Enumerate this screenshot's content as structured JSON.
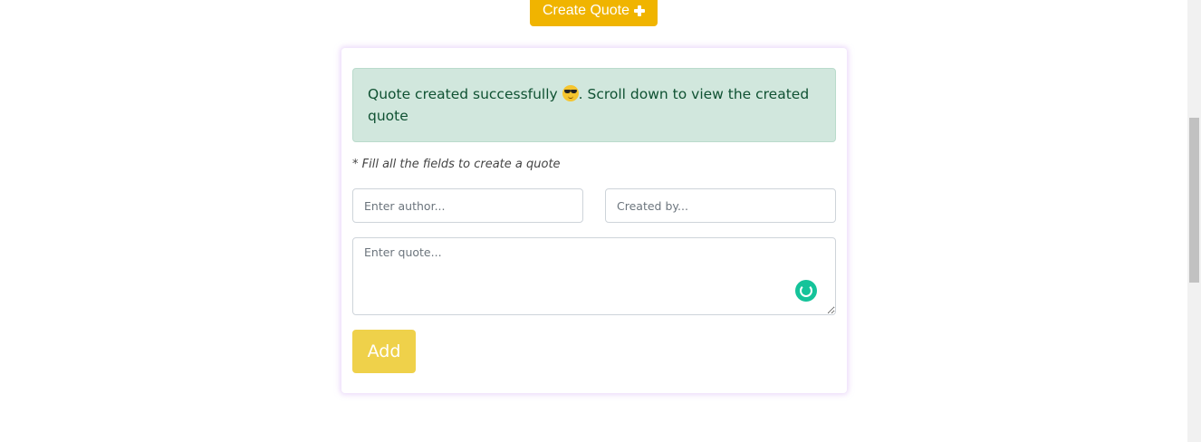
{
  "header": {
    "create_button_label": "Create Quote",
    "create_button_icon": "plus-icon"
  },
  "form": {
    "alert": {
      "text_before_emoji": "Quote created successfully ",
      "emoji_icon": "sunglasses-face-icon",
      "text_after_emoji": ". Scroll down to view the created quote"
    },
    "hint": "* Fill all the fields to create a quote",
    "author_placeholder": "Enter author...",
    "author_value": "",
    "created_by_placeholder": "Created by...",
    "created_by_value": "",
    "quote_placeholder": "Enter quote...",
    "quote_value": "",
    "grammarly_icon": "grammarly-icon",
    "add_button_label": "Add"
  },
  "colors": {
    "create_button": "#f0b400",
    "add_button": "#efd14a",
    "alert_background": "#d1e7dd",
    "alert_text": "#0f5132"
  }
}
